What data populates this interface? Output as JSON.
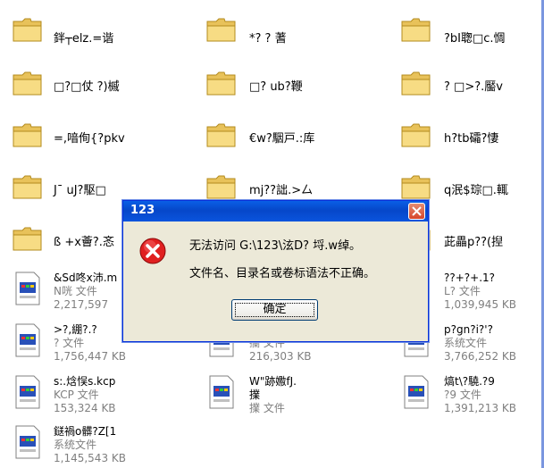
{
  "folders": [
    {
      "name": "鉡┬elz.=谐"
    },
    {
      "name": "*?    ? 蓍"
    },
    {
      "name": "?bI聦□c.惆"
    },
    {
      "name": "□?□仗  ?)槭"
    },
    {
      "name": "□?   ub?鞭"
    },
    {
      "name": "?   □>?.靨v"
    },
    {
      "name": "=,喑侚{?pkv"
    },
    {
      "name": "€w?駰戸.:库"
    },
    {
      "name": "h?tb礵?悽"
    },
    {
      "name": "J¯   uJ?駆□"
    },
    {
      "name": "mj??詘.>厶"
    },
    {
      "name": "q泯$琮□.輒"
    },
    {
      "name": "ß +x薈?.忞"
    },
    {
      "name": ""
    },
    {
      "name": "茈畾p??(揑"
    }
  ],
  "files": [
    {
      "name": "&Sd咚x沛.m",
      "type": "N咣 文件",
      "size": "2,217,597"
    },
    {
      "name": "",
      "type": "",
      "size": ""
    },
    {
      "name": "??+?+.1?",
      "type": "L? 文件",
      "size": "1,039,945 KB"
    },
    {
      "name": ">?,綳?.?",
      "type": "? 文件",
      "size": "1,756,447 KB"
    },
    {
      "name": "",
      "type": "攔 文件",
      "size": "216,303 KB"
    },
    {
      "name": "p?gn?i?'?",
      "type": "系统文件",
      "size": "3,766,252 KB"
    },
    {
      "name": "s:.焓悮s.kcp",
      "type": "KCP 文件",
      "size": "153,324 KB"
    },
    {
      "name": "W\"跡嫐fJ.",
      "type": "擈",
      "size": "擈 文件"
    },
    {
      "name": "熇t\\?驍.?9",
      "type": "?9 文件",
      "size": "1,391,213 KB"
    },
    {
      "name": "鎹禍o髒?Z[1",
      "type": "系统文件",
      "size": "1,145,543 KB"
    }
  ],
  "dialog": {
    "title": "123",
    "message_line1": "无法访问 G:\\123\\泫D?  埒.w绰。",
    "message_line2": "文件名、目录名或卷标语法不正确。",
    "ok_label": "确定",
    "icon": "error-icon"
  },
  "colors": {
    "title_bar": "#0a54dd",
    "dialog_face": "#ece9d8",
    "folder_yellow": "#f5d97a",
    "close_red": "#d7462a",
    "error_red": "#e02020"
  }
}
